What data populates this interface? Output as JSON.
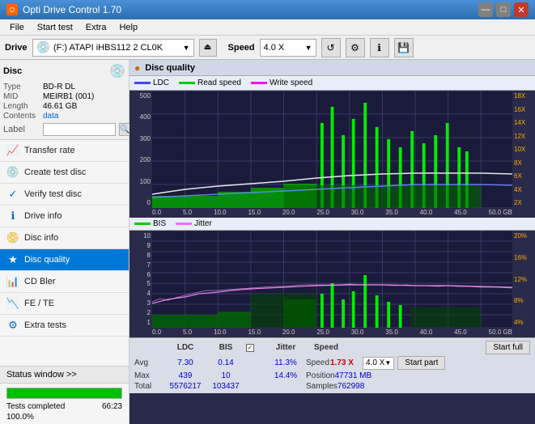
{
  "titleBar": {
    "title": "Opti Drive Control 1.70",
    "icon": "O",
    "minimize": "—",
    "maximize": "□",
    "close": "✕"
  },
  "menuBar": {
    "items": [
      "File",
      "Start test",
      "Extra",
      "Help"
    ]
  },
  "driveBar": {
    "driveLabel": "Drive",
    "driveValue": "(F:)  ATAPI iHBS112  2 CL0K",
    "speedLabel": "Speed",
    "speedValue": "4.0 X"
  },
  "disc": {
    "title": "Disc",
    "type": {
      "label": "Type",
      "value": "BD-R DL"
    },
    "mid": {
      "label": "MID",
      "value": "MEIRB1 (001)"
    },
    "length": {
      "label": "Length",
      "value": "46.61 GB"
    },
    "contents": {
      "label": "Contents",
      "value": "data"
    },
    "labelLabel": "Label"
  },
  "navItems": [
    {
      "id": "transfer-rate",
      "label": "Transfer rate",
      "icon": "📈"
    },
    {
      "id": "create-test-disc",
      "label": "Create test disc",
      "icon": "💿"
    },
    {
      "id": "verify-test-disc",
      "label": "Verify test disc",
      "icon": "✓"
    },
    {
      "id": "drive-info",
      "label": "Drive info",
      "icon": "ℹ"
    },
    {
      "id": "disc-info",
      "label": "Disc info",
      "icon": "📀"
    },
    {
      "id": "disc-quality",
      "label": "Disc quality",
      "icon": "★",
      "active": true
    },
    {
      "id": "cd-bler",
      "label": "CD Bler",
      "icon": "📊"
    },
    {
      "id": "fe-te",
      "label": "FE / TE",
      "icon": "📉"
    },
    {
      "id": "extra-tests",
      "label": "Extra tests",
      "icon": "⚙"
    }
  ],
  "statusWindow": {
    "label": "Status window >>",
    "statusText": "Tests completed",
    "progress": 100,
    "progressValue": "100.0%",
    "elapsed": "66:23"
  },
  "chartHeader": {
    "title": "Disc quality",
    "icon": "●"
  },
  "legend1": {
    "items": [
      {
        "id": "ldc",
        "label": "LDC",
        "color": "#4444ff"
      },
      {
        "id": "read",
        "label": "Read speed",
        "color": "#00cc00"
      },
      {
        "id": "write",
        "label": "Write speed",
        "color": "#ff66ff"
      }
    ]
  },
  "legend2": {
    "items": [
      {
        "id": "bis",
        "label": "BIS",
        "color": "#00cc00"
      },
      {
        "id": "jitter",
        "label": "Jitter",
        "color": "#ff66ff"
      }
    ]
  },
  "chart1": {
    "yAxisLeft": [
      "500",
      "400",
      "300",
      "200",
      "100",
      "0"
    ],
    "yAxisRight": [
      "18X",
      "16X",
      "14X",
      "12X",
      "10X",
      "8X",
      "6X",
      "4X",
      "2X"
    ],
    "xAxisLabels": [
      "0.0",
      "5.0",
      "10.0",
      "15.0",
      "20.0",
      "25.0",
      "30.0",
      "35.0",
      "40.0",
      "45.0",
      "50.0 GB"
    ]
  },
  "chart2": {
    "yAxisLeft": [
      "10",
      "9",
      "8",
      "7",
      "6",
      "5",
      "4",
      "3",
      "2",
      "1"
    ],
    "yAxisRight": [
      "20%",
      "16%",
      "12%",
      "8%",
      "4%"
    ],
    "xAxisLabels": [
      "0.0",
      "5.0",
      "10.0",
      "15.0",
      "20.0",
      "25.0",
      "30.0",
      "35.0",
      "40.0",
      "45.0",
      "50.0 GB"
    ]
  },
  "stats": {
    "headers": [
      "",
      "LDC",
      "BIS",
      "",
      "Jitter",
      "Speed",
      ""
    ],
    "avg": {
      "label": "Avg",
      "ldc": "7.30",
      "bis": "0.14",
      "jitter": "11.3%",
      "speed": "1.73 X"
    },
    "max": {
      "label": "Max",
      "ldc": "439",
      "bis": "10",
      "jitter": "14.4%",
      "position": "47731 MB"
    },
    "total": {
      "label": "Total",
      "ldc": "5576217",
      "bis": "103437",
      "samples": "762998"
    },
    "speedSelect": "4.0 X",
    "jitterChecked": true,
    "buttons": {
      "startFull": "Start full",
      "startPart": "Start part"
    },
    "positionLabel": "Position",
    "samplesLabel": "Samples"
  }
}
